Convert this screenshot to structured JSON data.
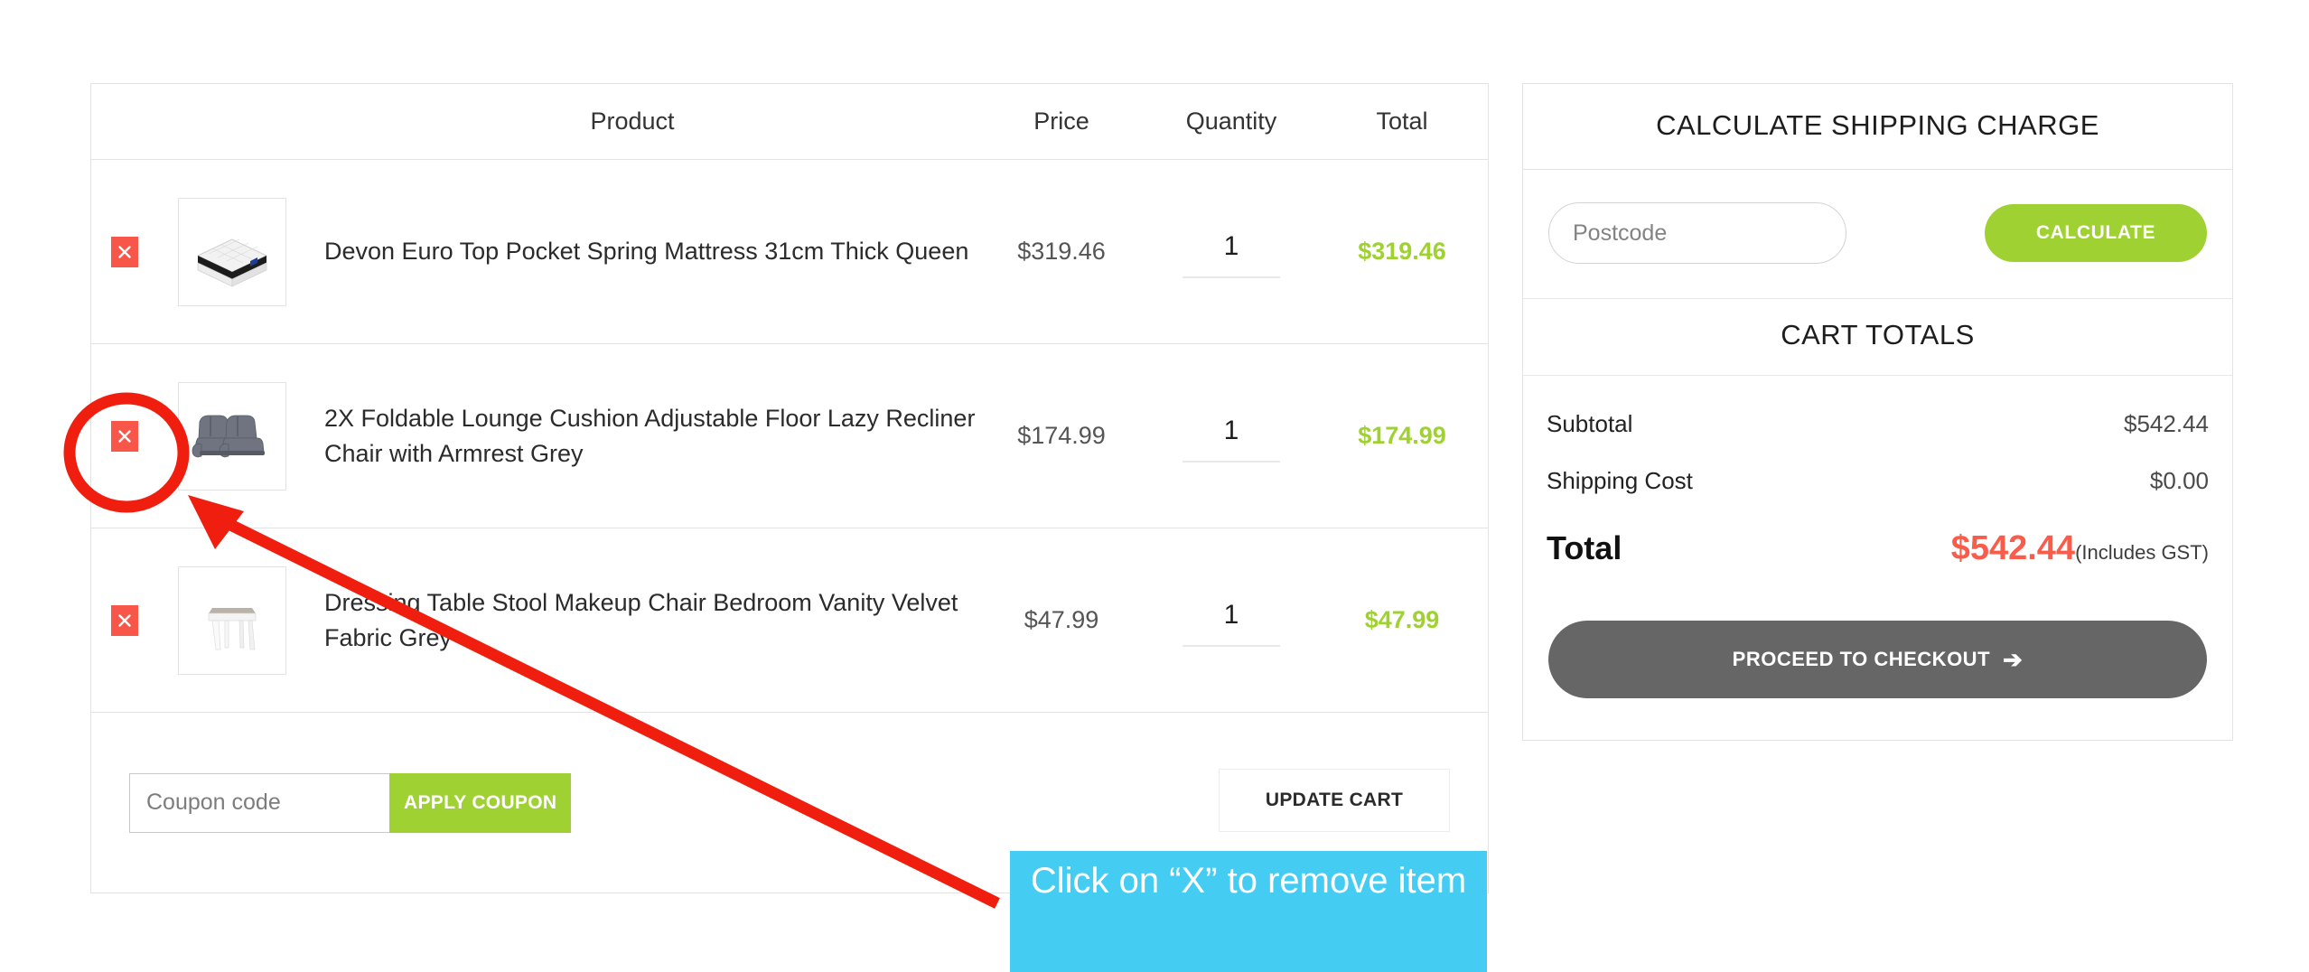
{
  "table": {
    "headers": {
      "product": "Product",
      "price": "Price",
      "quantity": "Quantity",
      "total": "Total"
    },
    "rows": [
      {
        "remove_label": "×",
        "name": "Devon Euro Top Pocket Spring Mattress 31cm Thick Queen",
        "price": "$319.46",
        "quantity": "1",
        "total": "$319.46",
        "thumb": "mattress-thumbnail"
      },
      {
        "remove_label": "×",
        "name": "2X Foldable Lounge Cushion Adjustable Floor Lazy Recliner Chair with Armrest Grey",
        "price": "$174.99",
        "quantity": "1",
        "total": "$174.99",
        "thumb": "recliner-chair-thumbnail"
      },
      {
        "remove_label": "×",
        "name": "Dressing Table Stool Makeup Chair Bedroom Vanity Velvet Fabric Grey",
        "price": "$47.99",
        "quantity": "1",
        "total": "$47.99",
        "thumb": "vanity-stool-thumbnail"
      }
    ],
    "actions": {
      "coupon_placeholder": "Coupon code",
      "coupon_value": "",
      "apply_coupon_label": "APPLY COUPON",
      "update_cart_label": "UPDATE CART"
    }
  },
  "sidebar": {
    "shipping": {
      "title": "CALCULATE SHIPPING CHARGE",
      "postcode_placeholder": "Postcode",
      "postcode_value": "",
      "calculate_label": "CALCULATE"
    },
    "totals": {
      "title": "CART TOTALS",
      "rows": [
        {
          "label": "Subtotal",
          "value": "$542.44"
        },
        {
          "label": "Shipping Cost",
          "value": "$0.00"
        }
      ],
      "grand": {
        "label": "Total",
        "value": "$542.44",
        "note": "(Includes GST)"
      }
    },
    "checkout": {
      "label": "PROCEED TO CHECKOUT",
      "arrow": "➔"
    }
  },
  "annotation": {
    "callout_text": "Click on “X” to remove item",
    "highlight_color": "#44ccf2",
    "marker_color": "#f01e0e",
    "target_row_index": 1
  },
  "colors": {
    "accent_green": "#9fd133",
    "danger_red": "#f9564a",
    "total_red": "#fa5c4b",
    "checkout_grey": "#666666",
    "border_grey": "#e3e3e3"
  }
}
